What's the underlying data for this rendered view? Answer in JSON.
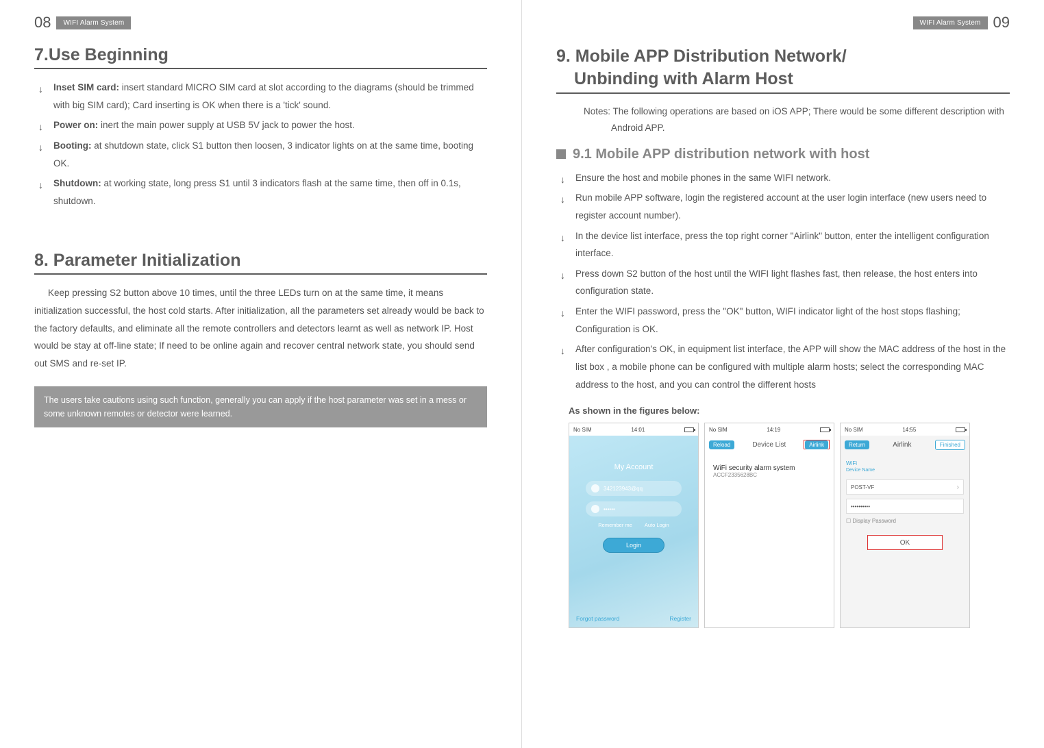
{
  "header": {
    "badge": "WIFI Alarm System",
    "page_left": "08",
    "page_right": "09"
  },
  "left": {
    "section7_title": "7.Use Beginning",
    "bullets7": [
      {
        "bold": "Inset SIM card:",
        "text": " insert standard MICRO SIM card at slot according to the diagrams (should be trimmed with big SIM card); Card inserting is OK when there is a 'tick' sound."
      },
      {
        "bold": "Power on:",
        "text": " inert the main power supply at USB 5V jack to power the host."
      },
      {
        "bold": "Booting:",
        "text": " at shutdown state, click S1 button then loosen, 3 indicator lights on at the same time, booting OK."
      },
      {
        "bold": "Shutdown:",
        "text": " at working state, long press S1 until 3 indicators flash at the same time, then off in 0.1s, shutdown."
      }
    ],
    "section8_title": "8. Parameter Initialization",
    "para8": "Keep pressing S2 button above 10 times, until the three LEDs turn on at the same time, it means initialization successful, the host cold starts. After initialization, all the parameters set already would be back to the factory defaults, and eliminate all the remote controllers and detectors learnt as well as network IP. Host would be stay at off-line state; If need to be online again and recover central network state, you should send out SMS and re-set IP.",
    "caution": "The users take cautions using such function, generally you can apply if the host parameter was set in a mess or some unknown remotes or detector were learned."
  },
  "right": {
    "section9_title_l1": "9. Mobile APP Distribution Network/",
    "section9_title_l2": "Unbinding with Alarm Host",
    "notes": "Notes: The following operations are based on iOS APP; There would be some different description with Android APP.",
    "sub91": "9.1 Mobile APP distribution network with host",
    "bullets91": [
      "Ensure the host and mobile phones in the same WIFI network.",
      "Run mobile APP software, login the registered account at the user login interface (new users need to register account number).",
      "In the device list interface, press the top right corner \"Airlink\" button, enter the intelligent configuration interface.",
      "Press down S2 button of the host until the WIFI light flashes fast, then release, the host enters into configuration state.",
      "Enter the WIFI password, press the \"OK\" button, WIFI indicator light of the host stops flashing; Configuration is OK.",
      "After configuration's OK, in equipment list interface, the APP will show the MAC address of the host in the list box , a mobile phone can be configured with multiple alarm hosts; select the corresponding MAC address to the host, and you can control the different hosts"
    ],
    "figures_caption": "As shown in the figures below:",
    "phone1": {
      "carrier": "No SIM",
      "time": "14:01",
      "title": "My Account",
      "user": "342123943@qq",
      "pass": "••••••",
      "remember": "Remember me",
      "auto": "Auto Login",
      "login": "Login",
      "forgot": "Forgot password",
      "register": "Register"
    },
    "phone2": {
      "carrier": "No SIM",
      "time": "14:19",
      "reload": "Reload",
      "title": "Device List",
      "airlink": "Airlink",
      "dev_title": "WiFi security alarm system",
      "dev_mac": "ACCF2335628BC"
    },
    "phone3": {
      "carrier": "No SIM",
      "time": "14:55",
      "return": "Return",
      "title": "Airlink",
      "finished": "Finished",
      "wifi_label": "WiFi",
      "wifi_sub": "Device Name",
      "ssid": "POST-VF",
      "pwd": "••••••••••",
      "display": "Display Password",
      "ok": "OK"
    }
  }
}
